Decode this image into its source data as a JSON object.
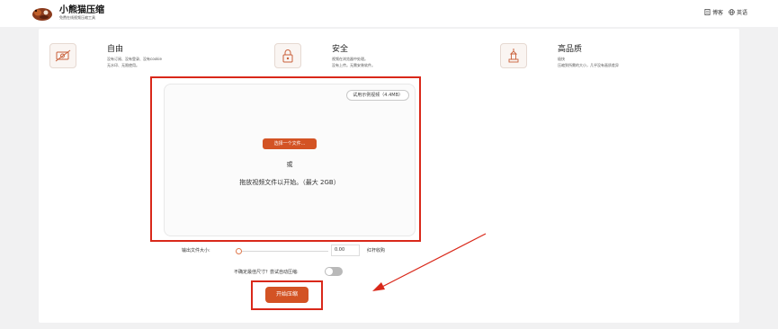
{
  "header": {
    "brand": "小熊猫压缩",
    "tagline": "免费在线视频压缩工具",
    "blog_label": "博客",
    "language_label": "英语"
  },
  "features": [
    {
      "icon": "no-cost-icon",
      "title": "自由",
      "lines": [
        "没有订阅、没有登录、没有cookie",
        "无水印、无限使用。"
      ]
    },
    {
      "icon": "security-lock-icon",
      "title": "安全",
      "lines": [
        "视频在浏览器中处理。",
        "没有上传。无需安装软件。"
      ]
    },
    {
      "icon": "quality-tower-icon",
      "title": "高品质",
      "lines": [
        "极快",
        "压缩到所需的大小，几乎没有画质差异"
      ]
    }
  ],
  "upload": {
    "try_sample_label": "试用示例视频（4.4MB）",
    "choose_file_label": "选择一个文件...",
    "or_label": "或",
    "drag_hint": "拖放视频文件以开始。（最大 2GB）"
  },
  "settings": {
    "size_label": "输出文件大小:",
    "size_value": "0.00",
    "size_unit": "红杆收购",
    "size_slider_fraction": 0,
    "auto_prompt": "不确定最佳尺寸？尝试自动压缩:",
    "auto_enabled": false
  },
  "actions": {
    "start_label": "开始压缩"
  },
  "colors": {
    "accent": "#d35324",
    "highlight": "#d9281a"
  }
}
